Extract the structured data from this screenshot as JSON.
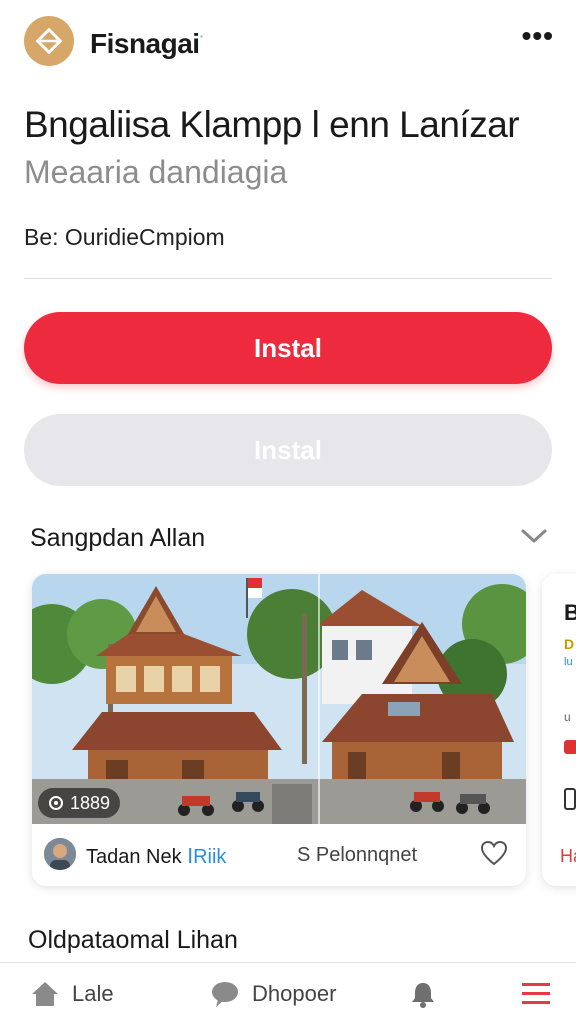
{
  "header": {
    "brand": "Fisnagai",
    "brand_mark": "·",
    "more_label": "•••"
  },
  "hero": {
    "title": "Bngaliisa Klampp l enn Lanízar",
    "subtitle": "Meaaria dandiagia",
    "byline": "Be: OuridieCmpiom"
  },
  "actions": {
    "primary_label": "Instal",
    "secondary_label": "Instal"
  },
  "section": {
    "title": "Sangpdan Allan"
  },
  "card": {
    "photo_count": "1889",
    "author_name": "Tadan Nek",
    "author_link": "ⅠRiik",
    "meta": "S Pelonnqnet"
  },
  "next_card": {
    "heading": "B",
    "tag": "D",
    "sub1": "lu",
    "sub2": "u",
    "footer": "Ha"
  },
  "bottom_heading": "Oldpataomal Lihan",
  "nav": {
    "home_label": "Lale",
    "chat_label": "Dhopoer"
  },
  "colors": {
    "accent": "#ee2a3e",
    "logo": "#d7a76a",
    "disabled": "#e6e6eb",
    "link": "#2a8fd8"
  },
  "icons": [
    "diamond-logo-icon",
    "more-icon",
    "chevron-down-icon",
    "camera-icon",
    "heart-icon",
    "home-icon",
    "chat-icon",
    "bell-icon",
    "menu-icon"
  ]
}
